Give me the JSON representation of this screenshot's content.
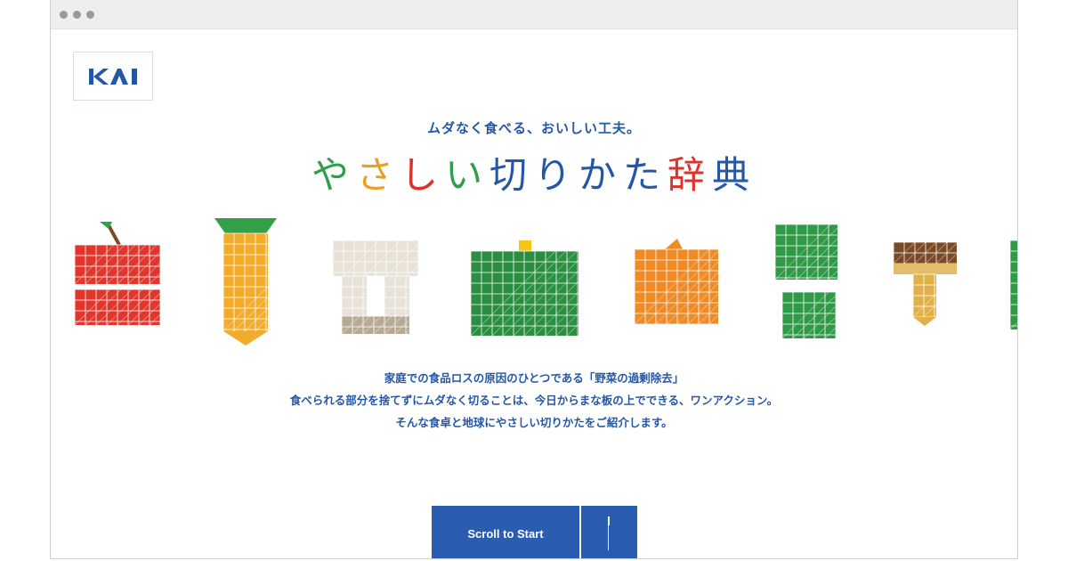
{
  "brand": {
    "logo_text": "KAI"
  },
  "hero": {
    "tagline": "ムダなく食べる、おいしい工夫。",
    "title_chars": [
      {
        "char": "や",
        "color": "#2e9e4a"
      },
      {
        "char": "さ",
        "color": "#e8a020"
      },
      {
        "char": "し",
        "color": "#d9332b"
      },
      {
        "char": "い",
        "color": "#2e9e4a"
      },
      {
        "char": "切",
        "color": "#2557a7"
      },
      {
        "char": "り",
        "color": "#2557a7"
      },
      {
        "char": "か",
        "color": "#2557a7"
      },
      {
        "char": "た",
        "color": "#2557a7"
      },
      {
        "char": "辞",
        "color": "#d9332b"
      },
      {
        "char": "典",
        "color": "#2557a7"
      }
    ]
  },
  "vegetables": [
    {
      "name": "apple",
      "main": "#e2362c"
    },
    {
      "name": "carrot",
      "main": "#f2ac2a",
      "leaf": "#35a04a"
    },
    {
      "name": "negi",
      "main": "#e7e1d6",
      "accent": "#b8a994"
    },
    {
      "name": "pumpkin",
      "main": "#2a8d3f",
      "stem": "#f5c518"
    },
    {
      "name": "onion",
      "main": "#f08a24"
    },
    {
      "name": "green-pepper",
      "main": "#2e9a45"
    },
    {
      "name": "mushroom",
      "main": "#e0b04a",
      "cap": "#7a4a26"
    },
    {
      "name": "partial",
      "main": "#2e9a45"
    }
  ],
  "intro": {
    "line1": "家庭での食品ロスの原因のひとつである「野菜の過剰除去」",
    "line2": "食べられる部分を捨てずにムダなく切ることは、今日からまな板の上でできる、ワンアクション。",
    "line3": "そんな食卓と地球にやさしい切りかたをご紹介します。"
  },
  "cta": {
    "scroll_label": "Scroll to Start"
  }
}
